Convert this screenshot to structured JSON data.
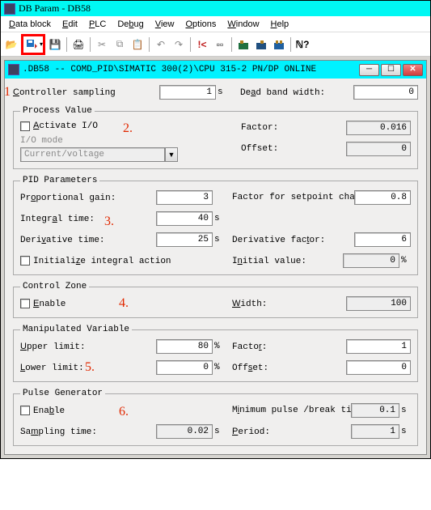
{
  "title": "DB Param - DB58",
  "menu": {
    "data_block": "Data block",
    "edit": "Edit",
    "plc": "PLC",
    "debug": "Debug",
    "view": "View",
    "options": "Options",
    "window": "Window",
    "help": "Help"
  },
  "annotations": {
    "n1": "1",
    "n2": "2.",
    "n3": "3.",
    "n4": "4.",
    "n5": "5.",
    "n6": "6."
  },
  "inner_title": ".DB58 -- COMD_PID\\SIMATIC 300(2)\\CPU 315-2 PN/DP  ONLINE",
  "top": {
    "controller_sampling_label": "Controller sampling",
    "controller_sampling_value": "1",
    "controller_sampling_unit": "s",
    "dead_band_label": "Dead band width:",
    "dead_band_value": "0"
  },
  "process_value": {
    "legend": "Process Value",
    "activate_io": "Activate I/O",
    "io_mode_label": "I/O mode",
    "io_mode_value": "Current/voltage",
    "factor_label": "Factor:",
    "factor_value": "0.016",
    "offset_label": "Offset:",
    "offset_value": "0"
  },
  "pid": {
    "legend": "PID Parameters",
    "prop_label": "Proportional gain:",
    "prop_value": "3",
    "setpt_label": "Factor for setpoint change:",
    "setpt_value": "0.8",
    "int_label": "Integral time:",
    "int_value": "40",
    "int_unit": "s",
    "der_label": "Derivative time:",
    "der_value": "25",
    "der_unit": "s",
    "derf_label": "Derivative factor:",
    "derf_value": "6",
    "init_label": "Initialize integral action",
    "iniv_label": "Initial value:",
    "iniv_value": "0",
    "iniv_unit": "%"
  },
  "ctrl_zone": {
    "legend": "Control Zone",
    "enable": "Enable",
    "width_label": "Width:",
    "width_value": "100"
  },
  "manip": {
    "legend": "Manipulated Variable",
    "upper_label": "Upper limit:",
    "upper_value": "80",
    "upper_unit": "%",
    "lower_label": "Lower limit:",
    "lower_value": "0",
    "lower_unit": "%",
    "factor_label": "Factor:",
    "factor_value": "1",
    "offset_label": "Offset:",
    "offset_value": "0"
  },
  "pulse": {
    "legend": "Pulse Generator",
    "enable": "Enable",
    "sampling_label": "Sampling time:",
    "sampling_value": "0.02",
    "sampling_unit": "s",
    "minp_label": "Minimum pulse /break time:",
    "minp_value": "0.1",
    "minp_unit": "s",
    "period_label": "Period:",
    "period_value": "1",
    "period_unit": "s"
  }
}
